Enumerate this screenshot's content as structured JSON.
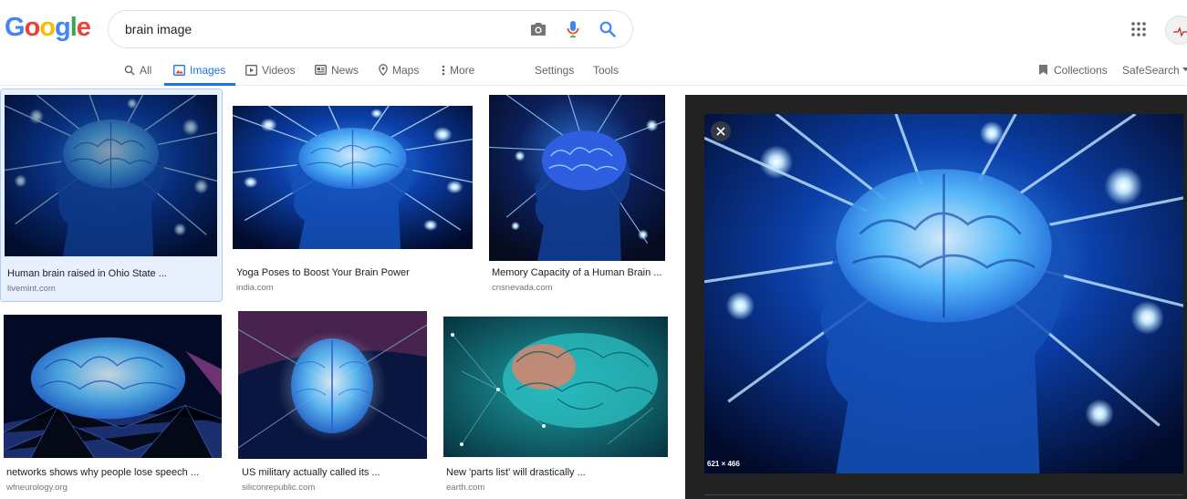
{
  "logo": {
    "letters": [
      "G",
      "o",
      "o",
      "g",
      "l",
      "e"
    ]
  },
  "search": {
    "query": "brain image"
  },
  "tabs": [
    {
      "label": "All",
      "icon": "search-icon"
    },
    {
      "label": "Images",
      "icon": "image-icon"
    },
    {
      "label": "Videos",
      "icon": "play-icon"
    },
    {
      "label": "News",
      "icon": "news-icon"
    },
    {
      "label": "Maps",
      "icon": "map-pin-icon"
    },
    {
      "label": "More",
      "icon": "more-vert-icon"
    }
  ],
  "tools": {
    "settings": "Settings",
    "tools": "Tools"
  },
  "right_links": {
    "collections": "Collections",
    "safesearch": "SafeSearch"
  },
  "results": [
    {
      "title": "Human brain raised in Ohio State ...",
      "source": "livemint.com",
      "selected": true
    },
    {
      "title": "Yoga Poses to Boost Your Brain Power",
      "source": "india.com"
    },
    {
      "title": "Memory Capacity of a Human Brain ...",
      "source": "cnsnevada.com"
    },
    {
      "title": "networks shows why people lose speech ...",
      "source": "wfneurology.org"
    },
    {
      "title": "US military actually called its ...",
      "source": "siliconrepublic.com"
    },
    {
      "title": "New 'parts list' will drastically ...",
      "source": "earth.com"
    }
  ],
  "preview": {
    "dimensions": "621 × 466"
  },
  "colors": {
    "accent": "#1a73e8",
    "google_blue": "#4285f4",
    "google_red": "#ea4335",
    "google_yellow": "#fbbc05",
    "google_green": "#34a853"
  }
}
